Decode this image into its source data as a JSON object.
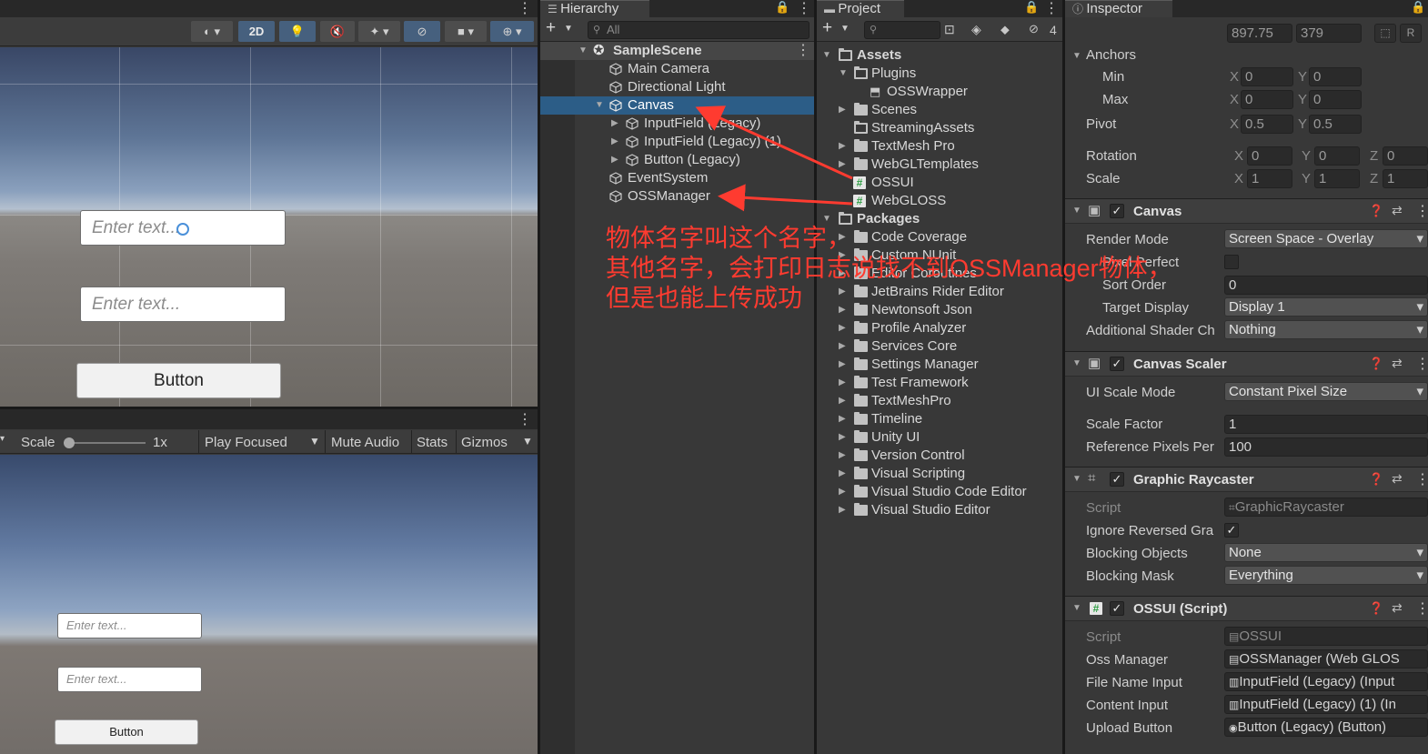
{
  "scene_view": {
    "toolbar": {
      "toggle_2d": "2D"
    },
    "inputs": [
      {
        "placeholder": "Enter text..."
      },
      {
        "placeholder": "Enter text..."
      }
    ],
    "button_label": "Button"
  },
  "game_view": {
    "toolbar": {
      "scale_label": "Scale",
      "scale_value": "1x",
      "play_focused": "Play Focused",
      "mute_audio": "Mute Audio",
      "stats": "Stats",
      "gizmos": "Gizmos"
    },
    "inputs": [
      {
        "placeholder": "Enter text..."
      },
      {
        "placeholder": "Enter text..."
      }
    ],
    "button_label": "Button"
  },
  "hierarchy": {
    "tab_label": "Hierarchy",
    "search_placeholder": "All",
    "scene_name": "SampleScene",
    "items": [
      {
        "label": "Main Camera"
      },
      {
        "label": "Directional Light"
      },
      {
        "label": "Canvas"
      },
      {
        "label": "InputField (Legacy)"
      },
      {
        "label": "InputField (Legacy) (1)"
      },
      {
        "label": "Button (Legacy)"
      },
      {
        "label": "EventSystem"
      },
      {
        "label": "OSSManager"
      }
    ]
  },
  "annotation": {
    "line1": "物体名字叫这个名字，",
    "line2": "其他名字，会打印日志说找不到OSSManager物体，",
    "line3": "但是也能上传成功",
    "color": "#ff3b30"
  },
  "project": {
    "tab_label": "Project",
    "hidden_count": "4",
    "assets_label": "Assets",
    "assets": [
      {
        "label": "Plugins"
      },
      {
        "label": "OSSWrapper"
      },
      {
        "label": "Scenes"
      },
      {
        "label": "StreamingAssets"
      },
      {
        "label": "TextMesh Pro"
      },
      {
        "label": "WebGLTemplates"
      },
      {
        "label": "OSSUI"
      },
      {
        "label": "WebGLOSS"
      }
    ],
    "packages_label": "Packages",
    "packages": [
      {
        "label": "Code Coverage"
      },
      {
        "label": "Custom NUnit"
      },
      {
        "label": "Editor Coroutines"
      },
      {
        "label": "JetBrains Rider Editor"
      },
      {
        "label": "Newtonsoft Json"
      },
      {
        "label": "Profile Analyzer"
      },
      {
        "label": "Services Core"
      },
      {
        "label": "Settings Manager"
      },
      {
        "label": "Test Framework"
      },
      {
        "label": "TextMeshPro"
      },
      {
        "label": "Timeline"
      },
      {
        "label": "Unity UI"
      },
      {
        "label": "Version Control"
      },
      {
        "label": "Visual Scripting"
      },
      {
        "label": "Visual Studio Code Editor"
      },
      {
        "label": "Visual Studio Editor"
      }
    ]
  },
  "inspector": {
    "tab_label": "Inspector",
    "size": {
      "w": "897.75",
      "h": "379"
    },
    "anchors": {
      "label": "Anchors",
      "min_label": "Min",
      "min_x": "0",
      "min_y": "0",
      "max_label": "Max",
      "max_x": "0",
      "max_y": "0"
    },
    "pivot": {
      "label": "Pivot",
      "x": "0.5",
      "y": "0.5"
    },
    "rotation": {
      "label": "Rotation",
      "x": "0",
      "y": "0",
      "z": "0"
    },
    "scale": {
      "label": "Scale",
      "x": "1",
      "y": "1",
      "z": "1"
    },
    "axis": {
      "x": "X",
      "y": "Y",
      "z": "Z"
    },
    "canvas": {
      "title": "Canvas",
      "render_mode_label": "Render Mode",
      "render_mode": "Screen Space - Overlay",
      "pixel_perfect_label": "Pixel Perfect",
      "sort_order_label": "Sort Order",
      "sort_order": "0",
      "target_display_label": "Target Display",
      "target_display": "Display 1",
      "shader_channels_label": "Additional Shader Ch",
      "shader_channels": "Nothing"
    },
    "canvas_scaler": {
      "title": "Canvas Scaler",
      "ui_scale_mode_label": "UI Scale Mode",
      "ui_scale_mode": "Constant Pixel Size",
      "scale_factor_label": "Scale Factor",
      "scale_factor": "1",
      "ref_ppu_label": "Reference Pixels Per",
      "ref_ppu": "100"
    },
    "graphic_raycaster": {
      "title": "Graphic Raycaster",
      "script_label": "Script",
      "script": "GraphicRaycaster",
      "ignore_reversed_label": "Ignore Reversed Gra",
      "blocking_objects_label": "Blocking Objects",
      "blocking_objects": "None",
      "blocking_mask_label": "Blocking Mask",
      "blocking_mask": "Everything"
    },
    "ossui": {
      "title": "OSSUI (Script)",
      "script_label": "Script",
      "script": "OSSUI",
      "oss_manager_label": "Oss Manager",
      "oss_manager": "OSSManager (Web GLOS",
      "file_name_input_label": "File Name Input",
      "file_name_input": "InputField (Legacy) (Input",
      "content_input_label": "Content Input",
      "content_input": "InputField (Legacy) (1) (In",
      "upload_button_label": "Upload Button",
      "upload_button": "Button (Legacy) (Button)"
    }
  }
}
